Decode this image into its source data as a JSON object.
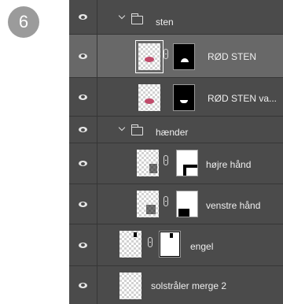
{
  "step_number": "6",
  "layers": {
    "sten_group": {
      "label": "sten"
    },
    "rod_sten": {
      "label": "RØD STEN"
    },
    "rod_sten_va": {
      "label": "RØD STEN va..."
    },
    "haender_group": {
      "label": "hænder"
    },
    "hojre_hand": {
      "label": "højre hånd"
    },
    "venstre_hand": {
      "label": "venstre hånd"
    },
    "engel": {
      "label": "engel"
    },
    "solstraler": {
      "label": "solstråler merge 2"
    }
  },
  "colors": {
    "panel_bg": "#4b4b4b",
    "selected_row": "#686868",
    "badge_bg": "#9b9b9b"
  },
  "icons": {
    "visibility": "eye-icon",
    "group": "folder-icon",
    "expand": "chevron-down-icon",
    "mask_link": "link-icon"
  }
}
